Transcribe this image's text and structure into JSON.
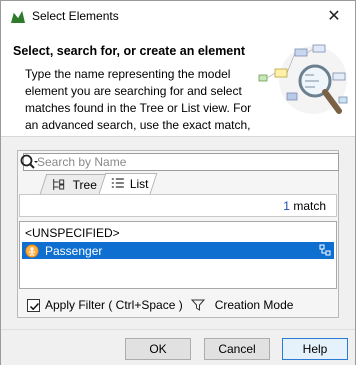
{
  "window": {
    "title": "Select Elements",
    "close_glyph": "✕",
    "app_icon": "magicdraw-icon"
  },
  "header": {
    "heading": "Select, search for, or create an element",
    "description": "Type the name representing the model\nelement you are searching for and select\nmatches found in the Tree or List view. For\nan advanced search, use the exact match,"
  },
  "search": {
    "placeholder": "Search by Name",
    "value": ""
  },
  "tabs": [
    {
      "label": "Tree",
      "icon": "tree-icon",
      "selected": false
    },
    {
      "label": "List",
      "icon": "list-icon",
      "selected": true
    }
  ],
  "results": {
    "count": "1",
    "count_suffix": " match"
  },
  "list": [
    {
      "label": "<UNSPECIFIED>",
      "selected": false
    },
    {
      "label": "Passenger",
      "icon": "actor-icon",
      "selected": true
    }
  ],
  "filter": {
    "checked": true,
    "label": "Apply Filter ( Ctrl+Space )",
    "creation_mode_label": "Creation Mode"
  },
  "buttons": {
    "ok": "OK",
    "cancel": "Cancel",
    "help": "Help"
  },
  "colors": {
    "selection": "#0f6fd1",
    "match_count": "#1b4fb0",
    "help_border": "#2a7ad5"
  }
}
